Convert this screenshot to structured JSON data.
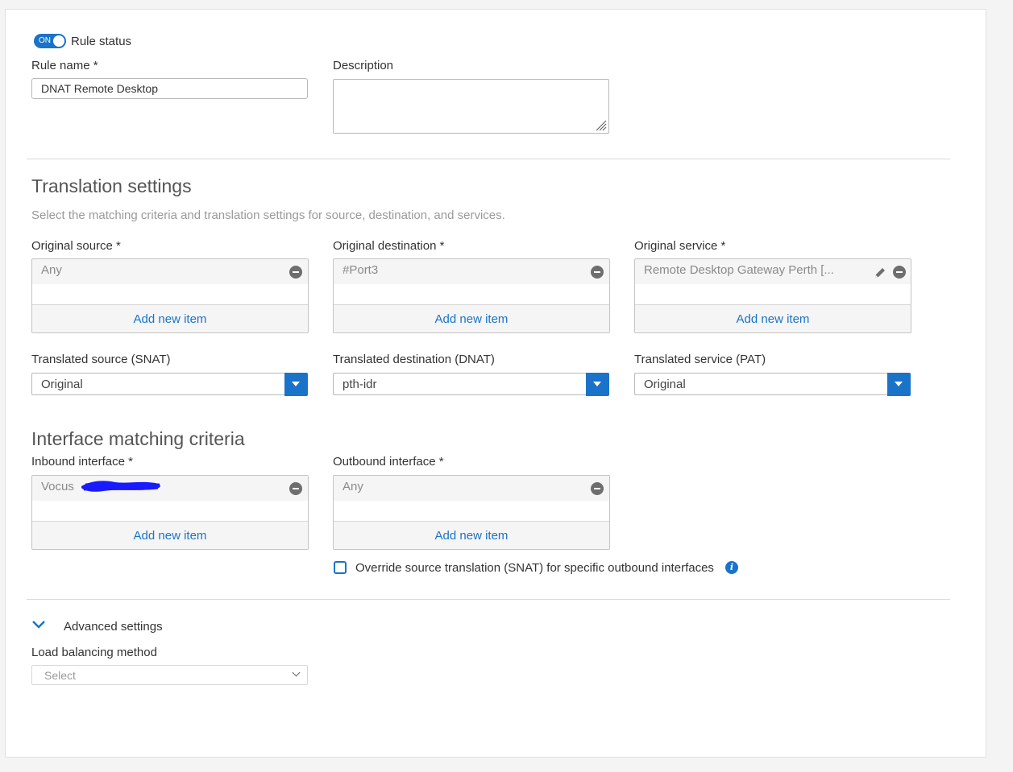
{
  "rule_status": {
    "toggle_text": "ON",
    "label": "Rule status"
  },
  "rule_name": {
    "label": "Rule name *",
    "value": "DNAT Remote Desktop"
  },
  "description": {
    "label": "Description",
    "value": ""
  },
  "translation": {
    "heading": "Translation settings",
    "subtitle": "Select the matching criteria and translation settings for source, destination, and services.",
    "original_source": {
      "label": "Original source *",
      "item": "Any",
      "add": "Add new item"
    },
    "original_destination": {
      "label": "Original destination *",
      "item": "#Port3",
      "add": "Add new item"
    },
    "original_service": {
      "label": "Original service *",
      "item": "Remote Desktop Gateway Perth [...",
      "add": "Add new item"
    },
    "translated_source": {
      "label": "Translated source (SNAT)",
      "value": "Original"
    },
    "translated_destination": {
      "label": "Translated destination (DNAT)",
      "value": "pth-idr"
    },
    "translated_service": {
      "label": "Translated service (PAT)",
      "value": "Original"
    }
  },
  "interface": {
    "heading": "Interface matching criteria",
    "inbound": {
      "label": "Inbound interface *",
      "item": "Vocus",
      "add": "Add new item"
    },
    "outbound": {
      "label": "Outbound interface *",
      "item": "Any",
      "add": "Add new item"
    },
    "override_label": "Override source translation (SNAT) for specific outbound interfaces"
  },
  "advanced": {
    "label": "Advanced settings",
    "load_balancing_label": "Load balancing method",
    "load_balancing_value": "Select"
  },
  "colors": {
    "accent": "#1a73c8",
    "scribble": "#1a1aff"
  },
  "icons": [
    "toggle-switch",
    "resize-handle-icon",
    "remove-icon",
    "pencil-icon",
    "dropdown-arrow-icon",
    "checkbox",
    "info-icon",
    "chevron-down-icon"
  ]
}
